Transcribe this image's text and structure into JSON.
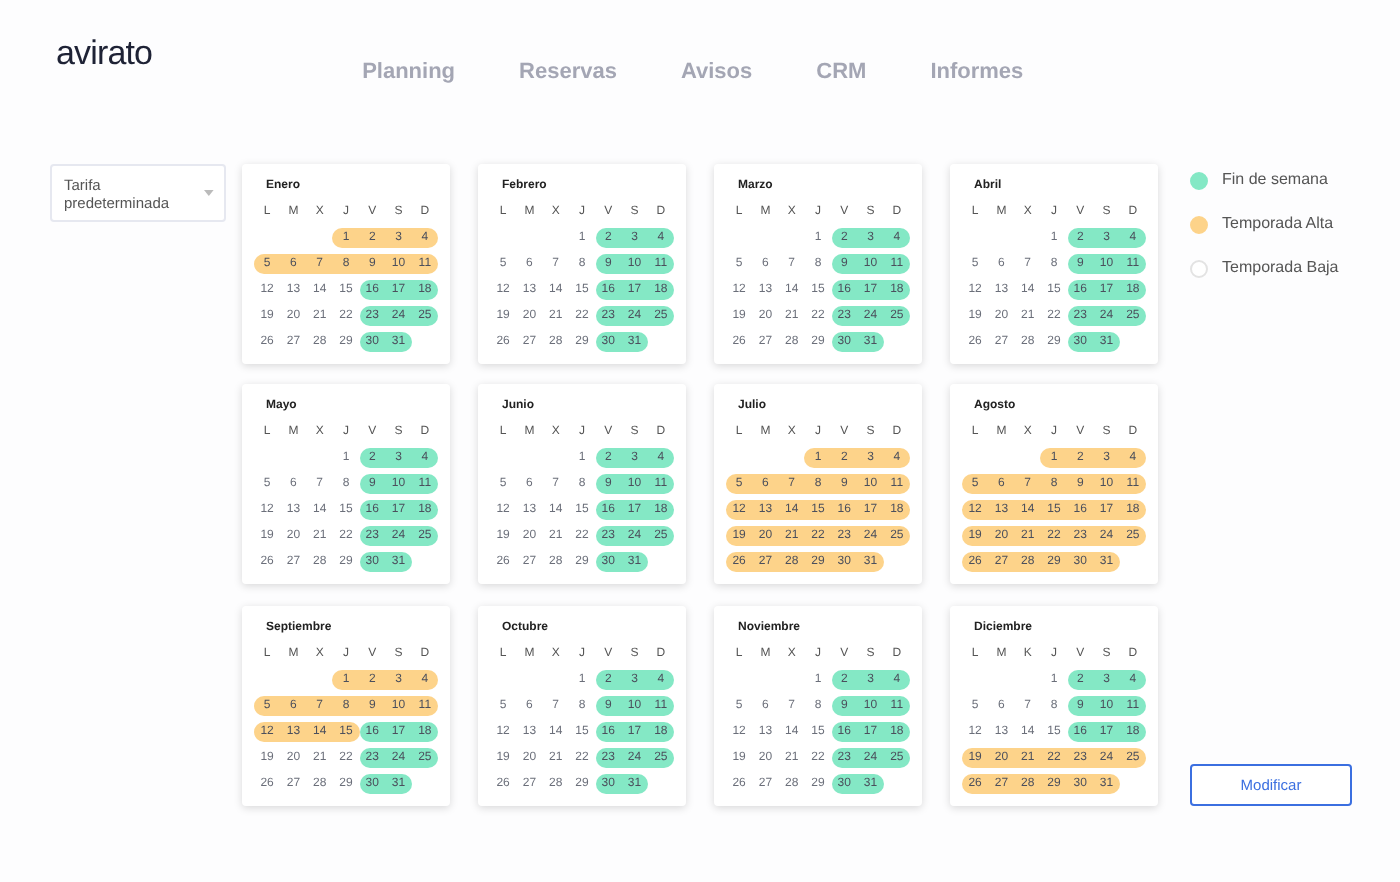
{
  "logo": "avirato",
  "nav": [
    "Planning",
    "Reservas",
    "Avisos",
    "CRM",
    "Informes"
  ],
  "rate_select": {
    "value": "Tarifa predeterminada"
  },
  "legend": [
    {
      "kind": "weekend",
      "label": "Fin de semana",
      "color": "#84e8c5"
    },
    {
      "kind": "alta",
      "label": "Temporada Alta",
      "color": "#fdd38a"
    },
    {
      "kind": "baja",
      "label": "Temporada Baja",
      "color": "#ffffff"
    }
  ],
  "months": [
    {
      "name": "Enero",
      "weekdays": [
        "L",
        "M",
        "X",
        "J",
        "V",
        "S",
        "D"
      ],
      "weeks": [
        [
          {
            "kind": "alta",
            "days": [
              "1",
              "2",
              "3",
              "4"
            ]
          }
        ],
        [
          {
            "kind": "alta",
            "days": [
              "5",
              "6",
              "7",
              "8",
              "9",
              "10",
              "11"
            ]
          }
        ],
        [
          {
            "kind": "baja",
            "days": [
              "12",
              "13",
              "14",
              "15"
            ]
          },
          {
            "kind": "weekend",
            "days": [
              "16",
              "17",
              "18"
            ]
          }
        ],
        [
          {
            "kind": "baja",
            "days": [
              "19",
              "20",
              "21",
              "22"
            ]
          },
          {
            "kind": "weekend",
            "days": [
              "23",
              "24",
              "25"
            ]
          }
        ],
        [
          {
            "kind": "baja",
            "days": [
              "26",
              "27",
              "28",
              "29"
            ]
          },
          {
            "kind": "weekend",
            "days": [
              "30",
              "31"
            ]
          }
        ]
      ]
    },
    {
      "name": "Febrero",
      "weekdays": [
        "L",
        "M",
        "X",
        "J",
        "V",
        "S",
        "D"
      ],
      "weeks": [
        [
          {
            "kind": "baja",
            "days": [
              "1"
            ]
          },
          {
            "kind": "weekend",
            "days": [
              "2",
              "3",
              "4"
            ]
          }
        ],
        [
          {
            "kind": "baja",
            "days": [
              "5",
              "6",
              "7",
              "8"
            ]
          },
          {
            "kind": "weekend",
            "days": [
              "9",
              "10",
              "11"
            ]
          }
        ],
        [
          {
            "kind": "baja",
            "days": [
              "12",
              "13",
              "14",
              "15"
            ]
          },
          {
            "kind": "weekend",
            "days": [
              "16",
              "17",
              "18"
            ]
          }
        ],
        [
          {
            "kind": "baja",
            "days": [
              "19",
              "20",
              "21",
              "22"
            ]
          },
          {
            "kind": "weekend",
            "days": [
              "23",
              "24",
              "25"
            ]
          }
        ],
        [
          {
            "kind": "baja",
            "days": [
              "26",
              "27",
              "28",
              "29"
            ]
          },
          {
            "kind": "weekend",
            "days": [
              "30",
              "31"
            ]
          }
        ]
      ]
    },
    {
      "name": "Marzo",
      "weekdays": [
        "L",
        "M",
        "X",
        "J",
        "V",
        "S",
        "D"
      ],
      "weeks": [
        [
          {
            "kind": "baja",
            "days": [
              "1"
            ]
          },
          {
            "kind": "weekend",
            "days": [
              "2",
              "3",
              "4"
            ]
          }
        ],
        [
          {
            "kind": "baja",
            "days": [
              "5",
              "6",
              "7",
              "8"
            ]
          },
          {
            "kind": "weekend",
            "days": [
              "9",
              "10",
              "11"
            ]
          }
        ],
        [
          {
            "kind": "baja",
            "days": [
              "12",
              "13",
              "14",
              "15"
            ]
          },
          {
            "kind": "weekend",
            "days": [
              "16",
              "17",
              "18"
            ]
          }
        ],
        [
          {
            "kind": "baja",
            "days": [
              "19",
              "20",
              "21",
              "22"
            ]
          },
          {
            "kind": "weekend",
            "days": [
              "23",
              "24",
              "25"
            ]
          }
        ],
        [
          {
            "kind": "baja",
            "days": [
              "26",
              "27",
              "28",
              "29"
            ]
          },
          {
            "kind": "weekend",
            "days": [
              "30",
              "31"
            ]
          }
        ]
      ]
    },
    {
      "name": "Abril",
      "weekdays": [
        "L",
        "M",
        "X",
        "J",
        "V",
        "S",
        "D"
      ],
      "weeks": [
        [
          {
            "kind": "baja",
            "days": [
              "1"
            ]
          },
          {
            "kind": "weekend",
            "days": [
              "2",
              "3",
              "4"
            ]
          }
        ],
        [
          {
            "kind": "baja",
            "days": [
              "5",
              "6",
              "7",
              "8"
            ]
          },
          {
            "kind": "weekend",
            "days": [
              "9",
              "10",
              "11"
            ]
          }
        ],
        [
          {
            "kind": "baja",
            "days": [
              "12",
              "13",
              "14",
              "15"
            ]
          },
          {
            "kind": "weekend",
            "days": [
              "16",
              "17",
              "18"
            ]
          }
        ],
        [
          {
            "kind": "baja",
            "days": [
              "19",
              "20",
              "21",
              "22"
            ]
          },
          {
            "kind": "weekend",
            "days": [
              "23",
              "24",
              "25"
            ]
          }
        ],
        [
          {
            "kind": "baja",
            "days": [
              "26",
              "27",
              "28",
              "29"
            ]
          },
          {
            "kind": "weekend",
            "days": [
              "30",
              "31"
            ]
          }
        ]
      ]
    },
    {
      "name": "Mayo",
      "weekdays": [
        "L",
        "M",
        "X",
        "J",
        "V",
        "S",
        "D"
      ],
      "weeks": [
        [
          {
            "kind": "baja",
            "days": [
              "1"
            ]
          },
          {
            "kind": "weekend",
            "days": [
              "2",
              "3",
              "4"
            ]
          }
        ],
        [
          {
            "kind": "baja",
            "days": [
              "5",
              "6",
              "7",
              "8"
            ]
          },
          {
            "kind": "weekend",
            "days": [
              "9",
              "10",
              "11"
            ]
          }
        ],
        [
          {
            "kind": "baja",
            "days": [
              "12",
              "13",
              "14",
              "15"
            ]
          },
          {
            "kind": "weekend",
            "days": [
              "16",
              "17",
              "18"
            ]
          }
        ],
        [
          {
            "kind": "baja",
            "days": [
              "19",
              "20",
              "21",
              "22"
            ]
          },
          {
            "kind": "weekend",
            "days": [
              "23",
              "24",
              "25"
            ]
          }
        ],
        [
          {
            "kind": "baja",
            "days": [
              "26",
              "27",
              "28",
              "29"
            ]
          },
          {
            "kind": "weekend",
            "days": [
              "30",
              "31"
            ]
          }
        ]
      ]
    },
    {
      "name": "Junio",
      "weekdays": [
        "L",
        "M",
        "X",
        "J",
        "V",
        "S",
        "D"
      ],
      "weeks": [
        [
          {
            "kind": "baja",
            "days": [
              "1"
            ]
          },
          {
            "kind": "weekend",
            "days": [
              "2",
              "3",
              "4"
            ]
          }
        ],
        [
          {
            "kind": "baja",
            "days": [
              "5",
              "6",
              "7",
              "8"
            ]
          },
          {
            "kind": "weekend",
            "days": [
              "9",
              "10",
              "11"
            ]
          }
        ],
        [
          {
            "kind": "baja",
            "days": [
              "12",
              "13",
              "14",
              "15"
            ]
          },
          {
            "kind": "weekend",
            "days": [
              "16",
              "17",
              "18"
            ]
          }
        ],
        [
          {
            "kind": "baja",
            "days": [
              "19",
              "20",
              "21",
              "22"
            ]
          },
          {
            "kind": "weekend",
            "days": [
              "23",
              "24",
              "25"
            ]
          }
        ],
        [
          {
            "kind": "baja",
            "days": [
              "26",
              "27",
              "28",
              "29"
            ]
          },
          {
            "kind": "weekend",
            "days": [
              "30",
              "31"
            ]
          }
        ]
      ]
    },
    {
      "name": "Julio",
      "weekdays": [
        "L",
        "M",
        "X",
        "J",
        "V",
        "S",
        "D"
      ],
      "weeks": [
        [
          {
            "kind": "alta",
            "days": [
              "1",
              "2",
              "3",
              "4"
            ]
          }
        ],
        [
          {
            "kind": "alta",
            "days": [
              "5",
              "6",
              "7",
              "8",
              "9",
              "10",
              "11"
            ]
          }
        ],
        [
          {
            "kind": "alta",
            "days": [
              "12",
              "13",
              "14",
              "15",
              "16",
              "17",
              "18"
            ]
          }
        ],
        [
          {
            "kind": "alta",
            "days": [
              "19",
              "20",
              "21",
              "22",
              "23",
              "24",
              "25"
            ]
          }
        ],
        [
          {
            "kind": "alta",
            "days": [
              "26",
              "27",
              "28",
              "29",
              "30",
              "31"
            ]
          }
        ]
      ]
    },
    {
      "name": "Agosto",
      "weekdays": [
        "L",
        "M",
        "X",
        "J",
        "V",
        "S",
        "D"
      ],
      "weeks": [
        [
          {
            "kind": "alta",
            "days": [
              "1",
              "2",
              "3",
              "4"
            ]
          }
        ],
        [
          {
            "kind": "alta",
            "days": [
              "5",
              "6",
              "7",
              "8",
              "9",
              "10",
              "11"
            ]
          }
        ],
        [
          {
            "kind": "alta",
            "days": [
              "12",
              "13",
              "14",
              "15",
              "16",
              "17",
              "18"
            ]
          }
        ],
        [
          {
            "kind": "alta",
            "days": [
              "19",
              "20",
              "21",
              "22",
              "23",
              "24",
              "25"
            ]
          }
        ],
        [
          {
            "kind": "alta",
            "days": [
              "26",
              "27",
              "28",
              "29",
              "30",
              "31"
            ]
          }
        ]
      ]
    },
    {
      "name": "Septiembre",
      "weekdays": [
        "L",
        "M",
        "X",
        "J",
        "V",
        "S",
        "D"
      ],
      "weeks": [
        [
          {
            "kind": "alta",
            "days": [
              "1",
              "2",
              "3",
              "4"
            ]
          }
        ],
        [
          {
            "kind": "alta",
            "days": [
              "5",
              "6",
              "7",
              "8",
              "9",
              "10",
              "11"
            ]
          }
        ],
        [
          {
            "kind": "alta",
            "days": [
              "12",
              "13",
              "14",
              "15"
            ]
          },
          {
            "kind": "weekend",
            "days": [
              "16",
              "17",
              "18"
            ]
          }
        ],
        [
          {
            "kind": "baja",
            "days": [
              "19",
              "20",
              "21",
              "22"
            ]
          },
          {
            "kind": "weekend",
            "days": [
              "23",
              "24",
              "25"
            ]
          }
        ],
        [
          {
            "kind": "baja",
            "days": [
              "26",
              "27",
              "28",
              "29"
            ]
          },
          {
            "kind": "weekend",
            "days": [
              "30",
              "31"
            ]
          }
        ]
      ]
    },
    {
      "name": "Octubre",
      "weekdays": [
        "L",
        "M",
        "X",
        "J",
        "V",
        "S",
        "D"
      ],
      "weeks": [
        [
          {
            "kind": "baja",
            "days": [
              "1"
            ]
          },
          {
            "kind": "weekend",
            "days": [
              "2",
              "3",
              "4"
            ]
          }
        ],
        [
          {
            "kind": "baja",
            "days": [
              "5",
              "6",
              "7",
              "8"
            ]
          },
          {
            "kind": "weekend",
            "days": [
              "9",
              "10",
              "11"
            ]
          }
        ],
        [
          {
            "kind": "baja",
            "days": [
              "12",
              "13",
              "14",
              "15"
            ]
          },
          {
            "kind": "weekend",
            "days": [
              "16",
              "17",
              "18"
            ]
          }
        ],
        [
          {
            "kind": "baja",
            "days": [
              "19",
              "20",
              "21",
              "22"
            ]
          },
          {
            "kind": "weekend",
            "days": [
              "23",
              "24",
              "25"
            ]
          }
        ],
        [
          {
            "kind": "baja",
            "days": [
              "26",
              "27",
              "28",
              "29"
            ]
          },
          {
            "kind": "weekend",
            "days": [
              "30",
              "31"
            ]
          }
        ]
      ]
    },
    {
      "name": "Noviembre",
      "weekdays": [
        "L",
        "M",
        "X",
        "J",
        "V",
        "S",
        "D"
      ],
      "weeks": [
        [
          {
            "kind": "baja",
            "days": [
              "1"
            ]
          },
          {
            "kind": "weekend",
            "days": [
              "2",
              "3",
              "4"
            ]
          }
        ],
        [
          {
            "kind": "baja",
            "days": [
              "5",
              "6",
              "7",
              "8"
            ]
          },
          {
            "kind": "weekend",
            "days": [
              "9",
              "10",
              "11"
            ]
          }
        ],
        [
          {
            "kind": "baja",
            "days": [
              "12",
              "13",
              "14",
              "15"
            ]
          },
          {
            "kind": "weekend",
            "days": [
              "16",
              "17",
              "18"
            ]
          }
        ],
        [
          {
            "kind": "baja",
            "days": [
              "19",
              "20",
              "21",
              "22"
            ]
          },
          {
            "kind": "weekend",
            "days": [
              "23",
              "24",
              "25"
            ]
          }
        ],
        [
          {
            "kind": "baja",
            "days": [
              "26",
              "27",
              "28",
              "29"
            ]
          },
          {
            "kind": "weekend",
            "days": [
              "30",
              "31"
            ]
          }
        ]
      ]
    },
    {
      "name": "Diciembre",
      "weekdays": [
        "L",
        "M",
        "K",
        "J",
        "V",
        "S",
        "D"
      ],
      "weeks": [
        [
          {
            "kind": "baja",
            "days": [
              "1"
            ]
          },
          {
            "kind": "weekend",
            "days": [
              "2",
              "3",
              "4"
            ]
          }
        ],
        [
          {
            "kind": "baja",
            "days": [
              "5",
              "6",
              "7",
              "8"
            ]
          },
          {
            "kind": "weekend",
            "days": [
              "9",
              "10",
              "11"
            ]
          }
        ],
        [
          {
            "kind": "baja",
            "days": [
              "12",
              "13",
              "14",
              "15"
            ]
          },
          {
            "kind": "weekend",
            "days": [
              "16",
              "17",
              "18"
            ]
          }
        ],
        [
          {
            "kind": "alta",
            "days": [
              "19",
              "20",
              "21",
              "22",
              "23",
              "24",
              "25"
            ]
          }
        ],
        [
          {
            "kind": "alta",
            "days": [
              "26",
              "27",
              "28",
              "29",
              "30",
              "31"
            ]
          }
        ]
      ]
    }
  ],
  "action_button": "Modificar"
}
